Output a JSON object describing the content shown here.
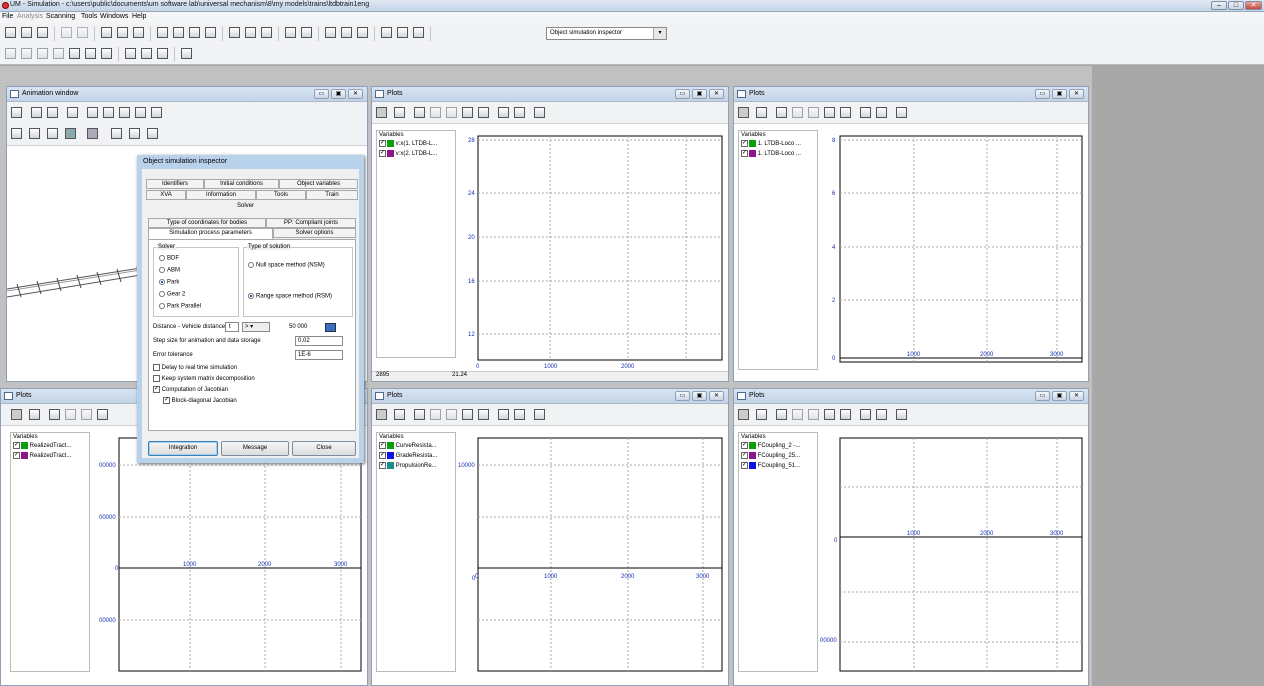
{
  "app": {
    "title": "UM - Simulation - c:\\users\\public\\documents\\um software lab\\universal mechanism\\8\\my models\\trains\\ltdbtrain1eng",
    "win_min": "–",
    "win_max": "□",
    "win_close": "✕"
  },
  "menu": [
    "File",
    "Analysis",
    "Scanning",
    "Tools",
    "Windows",
    "Help"
  ],
  "toolbar": {
    "combo": "Object simulation inspector"
  },
  "windows": {
    "animation_title": "Animation window",
    "plots_title": "Plots",
    "variables_header": "Variables",
    "btn_min": "▭",
    "btn_max": "▣",
    "btn_close": "✕"
  },
  "plots": [
    {
      "vars": [
        {
          "label": "v:x(1. LTDB-L...",
          "color": "#0a9e0a"
        },
        {
          "label": "v:x(2. LTDB-L...",
          "color": "#8b168b"
        }
      ],
      "yticks": [
        "28",
        "24",
        "20",
        "16",
        "12"
      ],
      "xticks": [
        "0",
        "1000",
        "2000"
      ],
      "status_left": "2895",
      "status_right": "21.24"
    },
    {
      "vars": [
        {
          "label": "1. LTDB-Loco ...",
          "color": "#0a9e0a"
        },
        {
          "label": "1. LTDB-Loco ...",
          "color": "#8b168b"
        }
      ],
      "yticks": [
        "8",
        "6",
        "4",
        "2",
        "0"
      ],
      "xticks": [
        "1000",
        "2000",
        "3000"
      ]
    },
    {
      "vars": [
        {
          "label": "RealizedTract...",
          "color": "#0a9e0a"
        },
        {
          "label": "RealizedTract...",
          "color": "#8b168b"
        }
      ],
      "yticks": [
        "00000",
        "00000",
        "0",
        "00000"
      ],
      "xticks": [
        "1000",
        "2000",
        "3000"
      ]
    },
    {
      "vars": [
        {
          "label": "CurveResista...",
          "color": "#0a9e0a"
        },
        {
          "label": "GradeResista...",
          "color": "#1010e0"
        },
        {
          "label": "PropulsionRe...",
          "color": "#1a8c8c"
        }
      ],
      "yticks": [
        "10000",
        "0"
      ],
      "xticks": [
        "0",
        "1000",
        "2000",
        "3000"
      ]
    },
    {
      "vars": [
        {
          "label": "FCoupling_2 -...",
          "color": "#0a9e0a"
        },
        {
          "label": "FCoupling_25...",
          "color": "#8b168b"
        },
        {
          "label": "FCoupling_51...",
          "color": "#1010e0"
        }
      ],
      "yticks": [
        "0",
        "00000"
      ],
      "xticks": [
        "1000",
        "2000",
        "3000"
      ]
    }
  ],
  "dialog": {
    "title": "Object simulation inspector",
    "tabs_row1": [
      "Identifiers",
      "Initial conditions",
      "Object variables"
    ],
    "tabs_row2": [
      "XVA",
      "Information",
      "Tools",
      "Train"
    ],
    "tab_solver": "Solver",
    "subtabs_row1": [
      "Type of coordinates for bodies",
      "PP: Compliant joints"
    ],
    "subtabs_row2": [
      "Simulation process parameters",
      "Solver options"
    ],
    "solver_group": "Solver",
    "solvers": [
      "BDF",
      "ABM",
      "Park",
      "Gear 2",
      "Park Parallel"
    ],
    "solution_group": "Type of solution",
    "solutions": [
      "Null space method (NSM)",
      "Range space method (RSM)"
    ],
    "distance_label": "Distance - Vehicle distance",
    "distance_t": "t",
    "distance_op": "> ▾",
    "distance_value": "50 000",
    "step_label": "Step size for animation and data storage",
    "step_value": "0.02",
    "tol_label": "Error tolerance",
    "tol_value": "1E-6",
    "checks": [
      "Delay to real time simulation",
      "Keep system matrix decomposition",
      "Computation of Jacobian",
      "Block-diagonal Jacobian"
    ],
    "btn_integration": "Integration",
    "btn_message": "Message",
    "btn_close": "Close"
  }
}
